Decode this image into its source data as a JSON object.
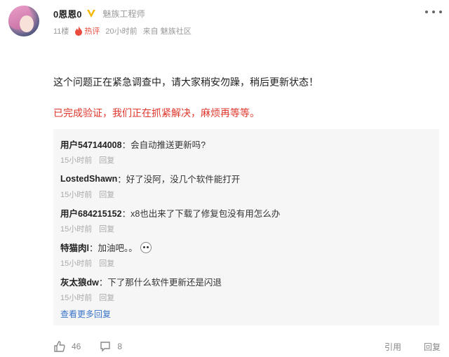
{
  "post": {
    "username": "0恩恩0",
    "role": "魅族工程师",
    "floor": "11楼",
    "hot_label": "热评",
    "time": "20小时前",
    "source": "来自 魅族社区",
    "body": "这个问题正在紧急调查中，请大家稍安勿躁，稍后更新状态！",
    "body_highlight": "已完成验证，我们正在抓紧解决，麻烦再等等。"
  },
  "replies": [
    {
      "name": "用户547144008",
      "text": "会自动推送更新吗?",
      "time": "15小时前",
      "reply_label": "回复"
    },
    {
      "name": "LostedShawn",
      "text": "好了没阿，没几个软件能打开",
      "time": "15小时前",
      "reply_label": "回复"
    },
    {
      "name": "用户684215152",
      "text": "x8也出来了下载了修复包没有用怎么办",
      "time": "15小时前",
      "reply_label": "回复"
    },
    {
      "name": "特猫肉l",
      "text": "加油吧。。",
      "time": "15小时前",
      "reply_label": "回复"
    },
    {
      "name": "灰太狼dw",
      "text": "下了那什么软件更新还是闪退",
      "time": "15小时前",
      "reply_label": "回复"
    }
  ],
  "see_more": "查看更多回复",
  "actions": {
    "likes": "46",
    "comments": "8",
    "quote": "引用",
    "reply": "回复"
  },
  "colors": {
    "highlight": "#e0362b",
    "hot": "#e94b3c",
    "link": "#3a74c9",
    "vbadge": "#f5b800"
  }
}
